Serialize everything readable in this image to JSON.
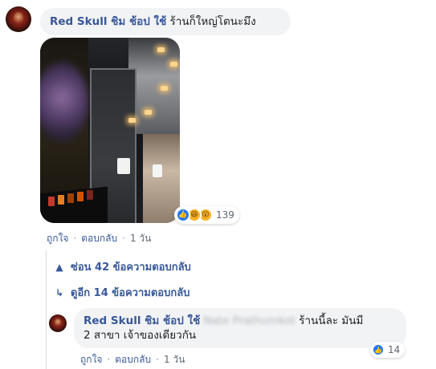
{
  "comment": {
    "author": "Red Skull ชิม ช้อป ใช้",
    "text": "ร้านก็ใหญ่โตนะมึง",
    "reactions": {
      "icons": [
        "like-icon",
        "haha-icon",
        "wow-icon"
      ],
      "count": "139"
    },
    "actions": {
      "like": "ถูกใจ",
      "reply": "ตอบกลับ",
      "time": "1 วัน"
    }
  },
  "thread": {
    "hide_replies": "ซ่อน 42 ข้อความตอบกลับ",
    "more_replies": "ดูอีก 14 ข้อความตอบกลับ"
  },
  "reply": {
    "author": "Red Skull ชิม ช้อป ใช้",
    "tagged_name": "Nate Prathumkot",
    "text": "ร้านนี้ละ มันมี",
    "text_line2": "2 สาขา เจ้าของเดียวกัน",
    "reactions": {
      "icons": [
        "like-icon"
      ],
      "count": "14"
    },
    "actions": {
      "like": "ถูกใจ",
      "reply": "ตอบกลับ",
      "time": "1 วัน"
    }
  },
  "colors": {
    "link": "#385898",
    "bubble": "#f2f3f5",
    "like": "#2078f4",
    "meta": "#606770"
  }
}
